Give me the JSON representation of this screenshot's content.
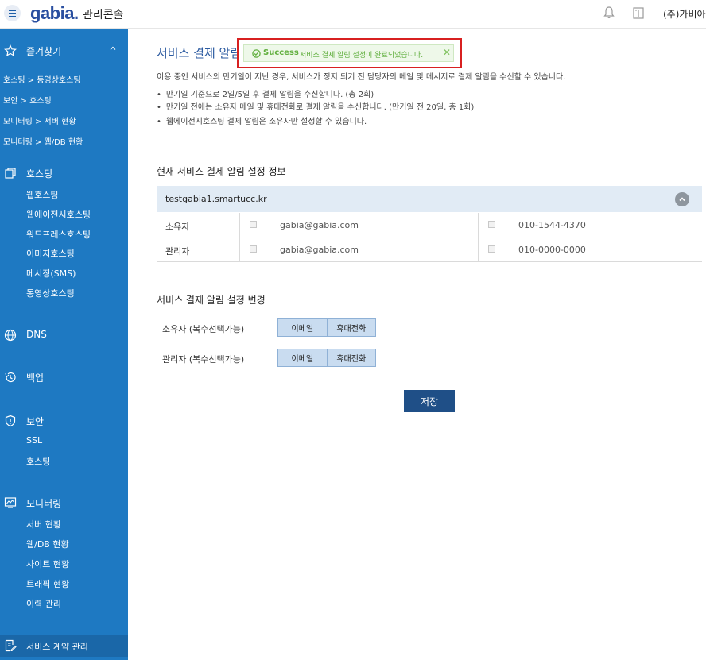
{
  "header": {
    "logo": "gabia.",
    "console_label": "관리콘솔",
    "company": "(주)가비아"
  },
  "sidebar": {
    "favorites_label": "즐겨찾기",
    "favorites": [
      "호스팅 > 동영상호스팅",
      "보안 > 호스팅",
      "모니터링 > 서버 현황",
      "모니터링 > 웹/DB 현황"
    ],
    "hosting": {
      "label": "호스팅",
      "items": [
        "웹호스팅",
        "웹에이전시호스팅",
        "워드프레스호스팅",
        "이미지호스팅",
        "메시징(SMS)",
        "동영상호스팅"
      ]
    },
    "dns": {
      "label": "DNS"
    },
    "backup": {
      "label": "백업"
    },
    "security": {
      "label": "보안",
      "items": [
        "SSL",
        "호스팅"
      ]
    },
    "monitoring": {
      "label": "모니터링",
      "items": [
        "서버 현황",
        "웹/DB 현황",
        "사이트 현황",
        "트래픽 현황",
        "이력 관리"
      ]
    },
    "contract": {
      "label": "서비스 계약 관리"
    }
  },
  "main": {
    "title": "서비스 결제 알림",
    "toast": {
      "title": "Success",
      "message": "서비스 결제 알림 설정이 완료되었습니다."
    },
    "description": "이용 중인 서비스의 만기일이 지난 경우, 서비스가 정지 되기 전 담당자의 메일 및 메시지로 결제 알림을 수신할 수 있습니다.",
    "bullets": [
      "만기일 기준으로 2일/5일 후 결제 알림을 수신합니다. (총 2회)",
      "만기일 전에는 소유자 메일 및 휴대전화로 결제 알림을 수신합니다. (만기일 전 20일, 총 1회)",
      "웹에이전시호스팅 결제 알림은 소유자만 설정할 수 있습니다."
    ],
    "current_heading": "현재 서비스 결제 알림 설정 정보",
    "service_name": "testgabia1.smartucc.kr",
    "rows": [
      {
        "role": "소유자",
        "email": "gabia@gabia.com",
        "phone": "010-1544-4370"
      },
      {
        "role": "관리자",
        "email": "gabia@gabia.com",
        "phone": "010-0000-0000"
      }
    ],
    "change_heading": "서비스 결제 알림 설정 변경",
    "options": [
      {
        "label": "소유자 (복수선택가능)",
        "email_btn": "이메일",
        "phone_btn": "휴대전화"
      },
      {
        "label": "관리자 (복수선택가능)",
        "email_btn": "이메일",
        "phone_btn": "휴대전화"
      }
    ],
    "save_label": "저장"
  }
}
